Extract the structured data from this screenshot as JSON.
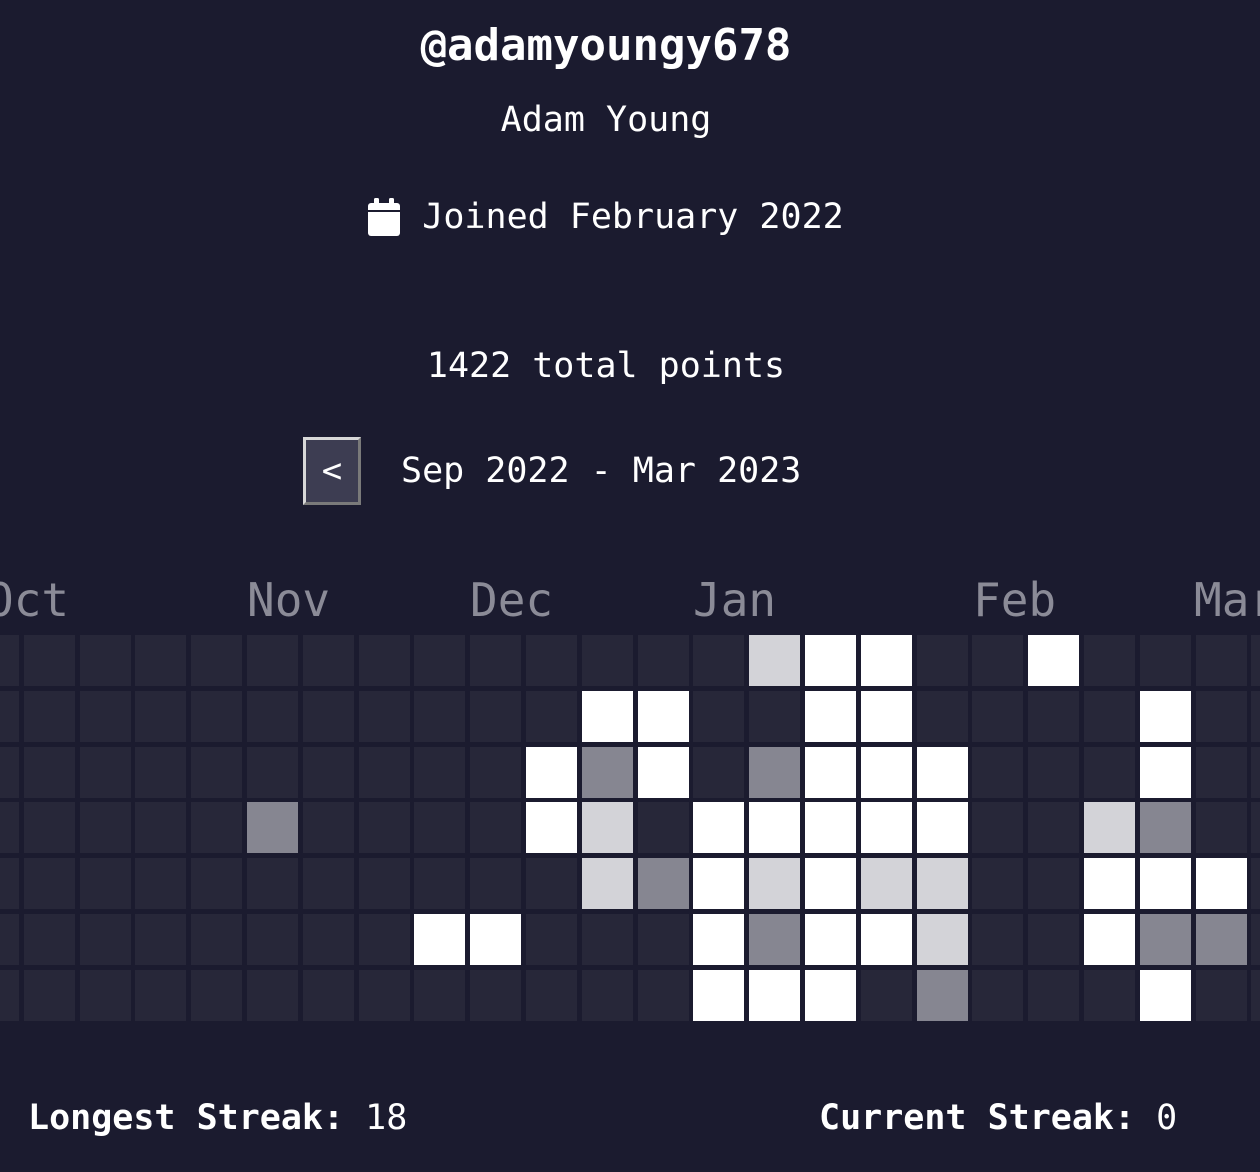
{
  "profile": {
    "username": "@adamyoungy678",
    "full_name": "Adam Young",
    "joined": "Joined February 2022",
    "total_points": "1422 total points"
  },
  "nav": {
    "prev_label": "<",
    "range": "Sep 2022 - Mar 2023"
  },
  "heatmap": {
    "months": [
      "Oct",
      "Nov",
      "Dec",
      "Jan",
      "Feb",
      "Mar"
    ],
    "levels": [
      [
        0,
        0,
        0,
        0,
        0,
        0,
        0,
        0,
        0,
        0,
        0,
        0,
        0,
        0,
        3,
        4,
        4,
        0,
        0,
        4,
        0,
        0,
        0,
        0
      ],
      [
        0,
        0,
        0,
        0,
        0,
        0,
        0,
        0,
        0,
        0,
        0,
        4,
        4,
        0,
        0,
        4,
        4,
        0,
        0,
        0,
        0,
        4,
        0,
        0
      ],
      [
        0,
        0,
        0,
        0,
        0,
        0,
        0,
        0,
        0,
        0,
        4,
        2,
        4,
        0,
        2,
        4,
        4,
        4,
        0,
        0,
        0,
        4,
        0,
        0
      ],
      [
        0,
        0,
        0,
        0,
        0,
        2,
        0,
        0,
        0,
        0,
        4,
        3,
        0,
        4,
        4,
        4,
        4,
        4,
        0,
        0,
        3,
        2,
        0,
        0
      ],
      [
        0,
        0,
        0,
        0,
        0,
        0,
        0,
        0,
        0,
        0,
        0,
        3,
        2,
        4,
        3,
        4,
        3,
        3,
        0,
        0,
        4,
        4,
        4,
        0
      ],
      [
        0,
        0,
        0,
        0,
        0,
        0,
        0,
        0,
        4,
        4,
        0,
        0,
        0,
        4,
        2,
        4,
        4,
        3,
        0,
        0,
        4,
        2,
        2,
        0
      ],
      [
        0,
        0,
        0,
        0,
        0,
        0,
        0,
        0,
        0,
        0,
        0,
        0,
        0,
        4,
        4,
        4,
        0,
        2,
        0,
        0,
        0,
        4,
        0,
        0
      ]
    ],
    "colors": [
      "#272739",
      "#272739",
      "#868691",
      "#d3d3d8",
      "#ffffff"
    ]
  },
  "stats": {
    "longest_label": "Longest Streak:",
    "longest_value": "18",
    "current_label": "Current Streak:",
    "current_value": "0"
  }
}
